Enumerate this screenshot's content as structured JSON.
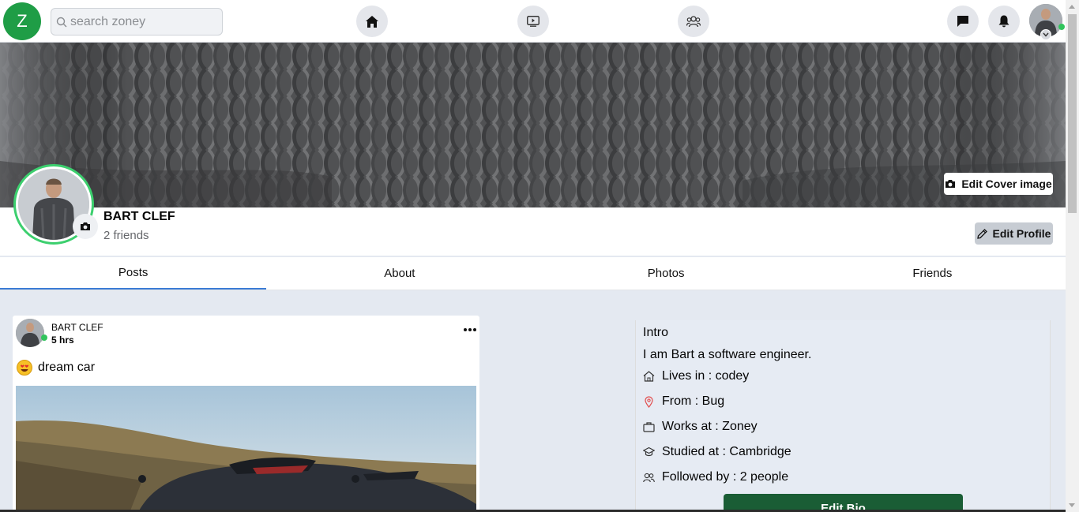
{
  "topbar": {
    "logo_letter": "Z",
    "search_placeholder": "search zoney"
  },
  "cover": {
    "edit_label": "Edit Cover image"
  },
  "profile": {
    "name": "BART CLEF",
    "friends": "2 friends",
    "edit_label": "Edit Profile"
  },
  "tabs": [
    "Posts",
    "About",
    "Photos",
    "Friends"
  ],
  "post": {
    "author": "BART CLEF",
    "time": "5 hrs",
    "text": "dream car"
  },
  "intro": {
    "title": "Intro",
    "bio": "I am Bart a software engineer.",
    "lives": "Lives in : codey",
    "from": "From : Bug",
    "works": "Works at : Zoney",
    "studied": "Studied at : Cambridge",
    "followed": "Followed by : 2 people",
    "edit_bio": "Edit Bio"
  },
  "colors": {
    "brand": "#1f9d46",
    "online": "#31c45c",
    "tab_active": "#3a7bd5",
    "edit_bio_bg": "#1a5d35"
  },
  "icons": [
    "search-icon",
    "home-icon",
    "video-icon",
    "groups-icon",
    "messenger-icon",
    "bell-icon",
    "camera-icon",
    "pencil-icon",
    "more-icon",
    "house-icon",
    "location-pin-icon",
    "briefcase-icon",
    "graduation-cap-icon",
    "people-icon"
  ]
}
